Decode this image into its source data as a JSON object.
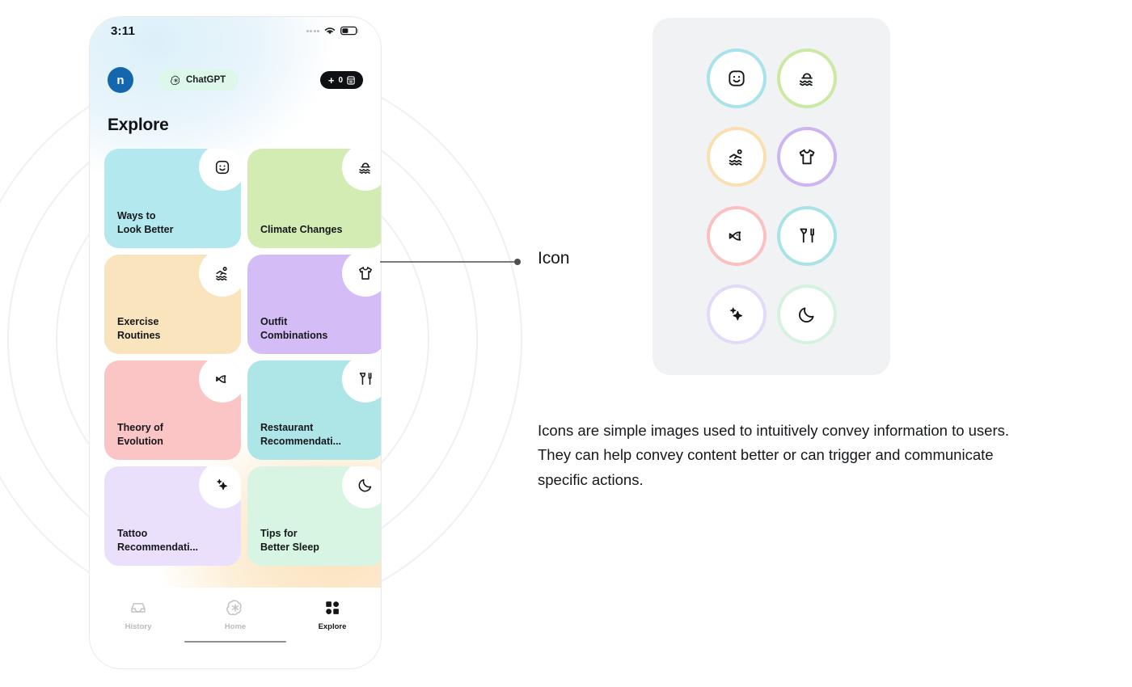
{
  "phone": {
    "status_bar": {
      "time": "3:11",
      "signal_icon": "signal-dots-icon",
      "wifi_icon": "wifi-icon",
      "battery_icon": "battery-icon"
    },
    "header": {
      "avatar_initial": "n",
      "avatar_color": "#1567ad",
      "model_pill_label": "ChatGPT",
      "model_pill_icon": "openai-logo-icon",
      "model_pill_color": "#ddf7ea",
      "new_chat_plus": "+",
      "new_chat_count": "0",
      "new_chat_icon": "archive-list-icon"
    },
    "page_title": "Explore",
    "cards": [
      {
        "label": "Ways to\nLook Better",
        "color": "#b3e8ef",
        "icon": "smiley-face-icon"
      },
      {
        "label": "Climate Changes",
        "color": "#d3ecb4",
        "icon": "sun-waves-icon"
      },
      {
        "label": "Exercise\nRoutines",
        "color": "#fae4bd",
        "icon": "swimmer-icon"
      },
      {
        "label": "Outfit\nCombinations",
        "color": "#d4bdf6",
        "icon": "tshirt-icon"
      },
      {
        "label": "Theory of\nEvolution",
        "color": "#fbc5c5",
        "icon": "fish-icon"
      },
      {
        "label": "Restaurant\nRecommendati...",
        "color": "#aee6e8",
        "icon": "cutlery-icon"
      },
      {
        "label": "Tattoo\nRecommendati...",
        "color": "#eae0fb",
        "icon": "sparkles-icon"
      },
      {
        "label": "Tips for\nBetter Sleep",
        "color": "#d8f5e3",
        "icon": "moon-icon"
      }
    ],
    "tabs": [
      {
        "label": "History",
        "icon": "inbox-icon",
        "active": false
      },
      {
        "label": "Home",
        "icon": "openai-logo-icon",
        "active": false
      },
      {
        "label": "Explore",
        "icon": "grid-squares-icon",
        "active": true
      }
    ]
  },
  "callout": {
    "label": "Icon",
    "line_icon": "leader-line-icon",
    "dot_icon": "endpoint-dot-icon"
  },
  "icon_panel": {
    "background": "#f1f2f4",
    "icons": [
      {
        "name": "smiley-face-icon",
        "ring": "#a9e2eb"
      },
      {
        "name": "sun-waves-icon",
        "ring": "#cce9a4"
      },
      {
        "name": "swimmer-icon",
        "ring": "#fadfb0"
      },
      {
        "name": "tshirt-icon",
        "ring": "#cdb4f2"
      },
      {
        "name": "fish-icon",
        "ring": "#fbc0c0"
      },
      {
        "name": "cutlery-icon",
        "ring": "#a8e3e7"
      },
      {
        "name": "sparkles-icon",
        "ring": "#e3d9f8"
      },
      {
        "name": "moon-icon",
        "ring": "#d5f2e0"
      }
    ]
  },
  "description": "Icons are simple images used to intuitively convey information to users. They can help convey content better or can trigger and communicate specific actions."
}
